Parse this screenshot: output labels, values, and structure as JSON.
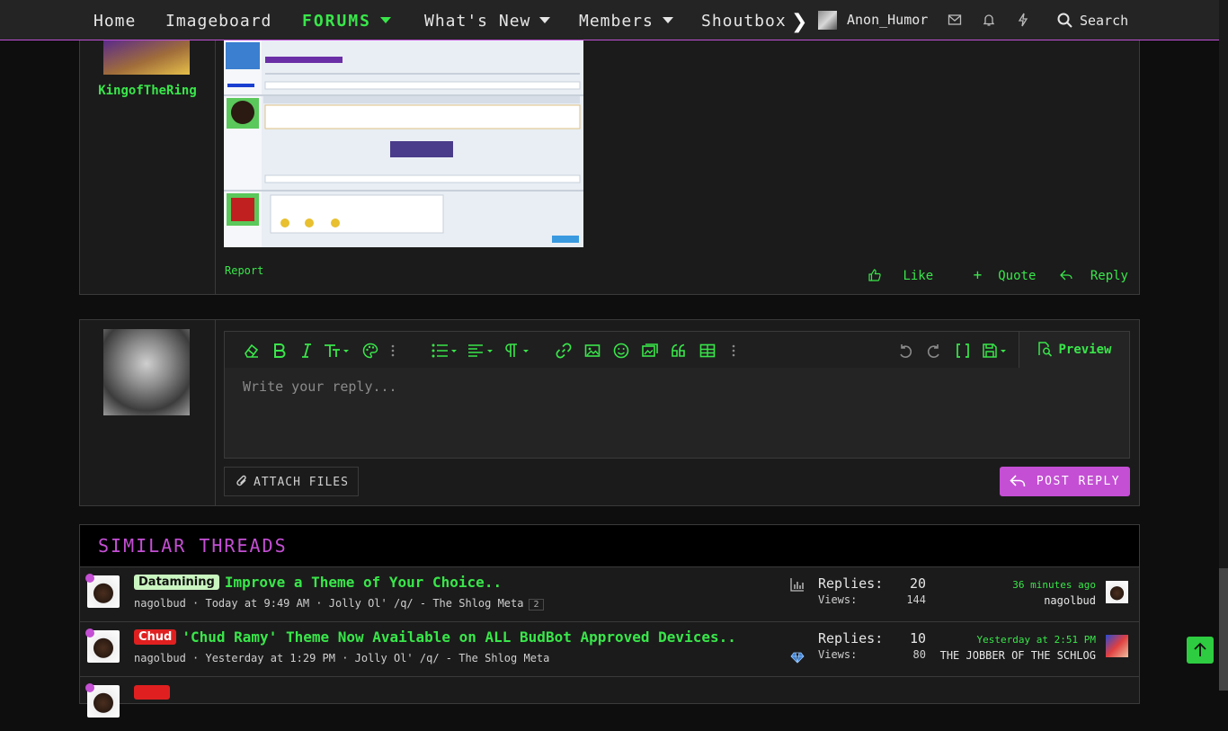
{
  "nav": {
    "items": [
      {
        "label": "Home"
      },
      {
        "label": "Imageboard"
      },
      {
        "label": "FORUMS"
      },
      {
        "label": "What's New"
      },
      {
        "label": "Members"
      },
      {
        "label": "Shoutbox"
      }
    ],
    "username": "Anon_Humor",
    "search_label": "Search"
  },
  "post": {
    "username": "KingofTheRing",
    "report_label": "Report",
    "actions": {
      "like": "Like",
      "quote": "Quote",
      "reply": "Reply"
    }
  },
  "editor": {
    "placeholder": "Write your reply...",
    "preview_label": "Preview",
    "attach_label": "ATTACH FILES",
    "post_reply_label": "POST REPLY"
  },
  "similar": {
    "heading": "SIMILAR THREADS",
    "threads": [
      {
        "prefix": "Datamining",
        "title": "Improve a Theme of Your Choice..",
        "meta": "nagolbud · Today at 9:49 AM · Jolly Ol' /q/ - The Shlog Meta",
        "pages": "2",
        "replies_label": "Replies:",
        "replies": "20",
        "views_label": "Views:",
        "views": "144",
        "last_date": "36 minutes ago",
        "last_user": "nagolbud"
      },
      {
        "prefix": "Chud",
        "title": "'Chud Ramy' Theme Now Available on ALL BudBot Approved Devices..",
        "meta": "nagolbud · Yesterday at 1:29 PM · Jolly Ol' /q/ - The Shlog Meta",
        "replies_label": "Replies:",
        "replies": "10",
        "views_label": "Views:",
        "views": "80",
        "last_date": "Yesterday at 2:51 PM",
        "last_user": "THE JOBBER OF THE SCHLOG"
      }
    ]
  },
  "colors": {
    "accent": "#39e64a",
    "brand": "#c44fd4",
    "label_red": "#e02020",
    "label_green": "#c9f5c0"
  }
}
